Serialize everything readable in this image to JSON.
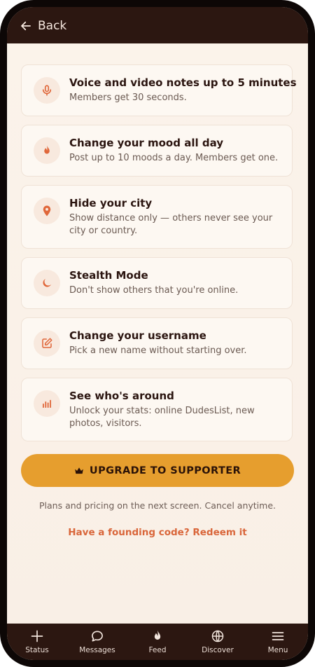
{
  "header": {
    "back_label": "Back"
  },
  "features": [
    {
      "icon": "microphone-icon",
      "title": "Voice and video notes up to 5 minutes",
      "description": "Members get 30 seconds."
    },
    {
      "icon": "flame-icon",
      "title": "Change your mood all day",
      "description": "Post up to 10 moods a day. Members get one."
    },
    {
      "icon": "location-pin-icon",
      "title": "Hide your city",
      "description": "Show distance only — others never see your city or country."
    },
    {
      "icon": "moon-icon",
      "title": "Stealth Mode",
      "description": "Don't show others that you're online."
    },
    {
      "icon": "edit-icon",
      "title": "Change your username",
      "description": "Pick a new name without starting over."
    },
    {
      "icon": "bar-chart-icon",
      "title": "See who's around",
      "description": "Unlock your stats: online DudesList, new photos, visitors."
    }
  ],
  "upgrade": {
    "label": "UPGRADE TO SUPPORTER",
    "icon": "crown-icon"
  },
  "pricing_note": "Plans and pricing on the next screen. Cancel anytime.",
  "redeem_link": "Have a founding code? Redeem it",
  "nav": [
    {
      "icon": "plus-icon",
      "label": "Status"
    },
    {
      "icon": "chat-bubble-icon",
      "label": "Messages"
    },
    {
      "icon": "flame-icon",
      "label": "Feed"
    },
    {
      "icon": "globe-icon",
      "label": "Discover"
    },
    {
      "icon": "hamburger-menu-icon",
      "label": "Menu"
    }
  ],
  "colors": {
    "header_bg": "#2c1711",
    "page_bg": "#fbf3ea",
    "accent": "#e69e2e",
    "icon_accent": "#e0673a",
    "link": "#d9663a",
    "title_text": "#2b1510"
  }
}
